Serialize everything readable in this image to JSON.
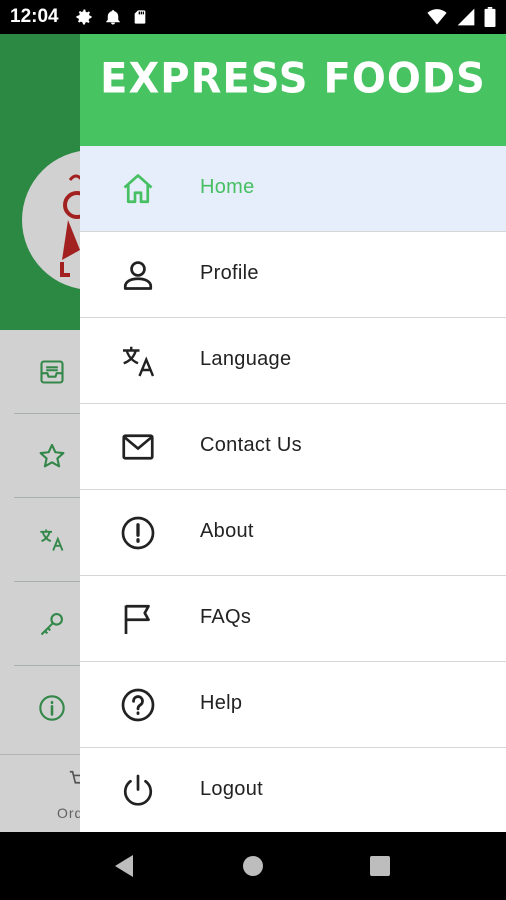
{
  "status_bar": {
    "time": "12:04",
    "left_icons": [
      "gear-icon",
      "bell-icon",
      "sd-card-icon"
    ],
    "right_icons": [
      "wifi-icon",
      "signal-icon",
      "battery-icon"
    ]
  },
  "background": {
    "bottom_tab_label": "Ord",
    "list_icons": [
      "tray-icon",
      "star-icon",
      "translate-icon",
      "key-icon",
      "info-icon"
    ]
  },
  "drawer": {
    "brand": "EXPRESS FOODS",
    "items": [
      {
        "label": "Home",
        "icon": "home-icon",
        "active": true
      },
      {
        "label": "Profile",
        "icon": "person-icon",
        "active": false
      },
      {
        "label": "Language",
        "icon": "translate-icon",
        "active": false
      },
      {
        "label": "Contact Us",
        "icon": "mail-icon",
        "active": false
      },
      {
        "label": "About",
        "icon": "alert-circle-icon",
        "active": false
      },
      {
        "label": "FAQs",
        "icon": "flag-icon",
        "active": false
      },
      {
        "label": "Help",
        "icon": "help-circle-icon",
        "active": false
      },
      {
        "label": "Logout",
        "icon": "power-icon",
        "active": false
      }
    ]
  },
  "colors": {
    "primary_green": "#48c361",
    "header_green_bg": "#35a852",
    "active_row_bg": "#e6edfb",
    "active_text": "#46c063"
  }
}
